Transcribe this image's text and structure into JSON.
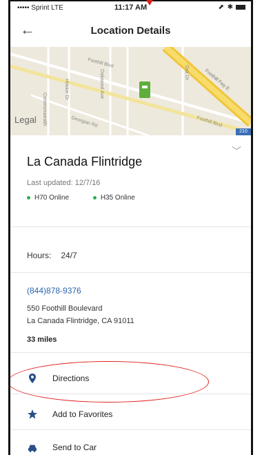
{
  "status_bar": {
    "carrier": "••••• Sprint  LTE",
    "time": "11:17 AM",
    "right": "⬈ ✱"
  },
  "nav": {
    "back_glyph": "←",
    "title": "Location Details"
  },
  "map": {
    "legal": "Legal",
    "streets": [
      "Commonwealth",
      "Hokkin Dr",
      "Oakwood Ave",
      "Foothill Blvd",
      "Georgian Rd",
      "Foothill Fwy E",
      "Foothill Blvd",
      "Oak Dr"
    ],
    "freeway_shield": "210"
  },
  "location": {
    "name": "La Canada Flintridge",
    "last_updated": "Last updated: 12/7/16",
    "statuses": [
      {
        "label": "H70 Online",
        "color": "#2fae49"
      },
      {
        "label": "H35 Online",
        "color": "#2fae49"
      }
    ],
    "hours_label": "Hours:",
    "hours_value": "24/7",
    "phone": "(844)878-9376",
    "address_line1": "550 Foothill Boulevard",
    "address_line2": "La Canada Flintridge, CA 91011",
    "distance": "33 miles"
  },
  "actions": [
    {
      "label": "Directions",
      "icon": "location-pin-icon"
    },
    {
      "label": "Add to Favorites",
      "icon": "star-icon"
    },
    {
      "label": "Send to Car",
      "icon": "car-icon"
    }
  ],
  "colors": {
    "accent": "#2a66b0",
    "online": "#2fae49",
    "annotation": "#e0211d"
  }
}
